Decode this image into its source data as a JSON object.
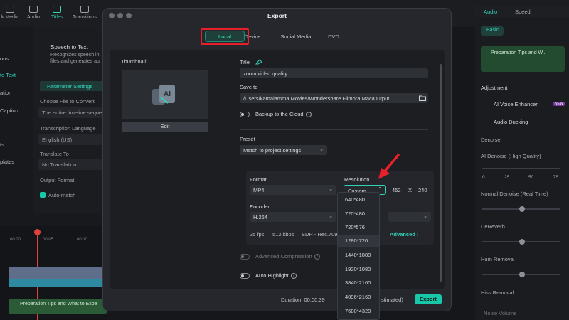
{
  "app_toolbar": {
    "tabs": [
      "k Media",
      "Audio",
      "Titles",
      "Transitions"
    ]
  },
  "left_rail": [
    "ons",
    "to Text",
    "ation",
    "Caption",
    "ts",
    "plates"
  ],
  "left_panel": {
    "heading": "Speech to Text",
    "desc1": "Recognizes speech in",
    "desc2": "files and generates au",
    "param_tab": "Parameter Settings",
    "choose_file_label": "Choose File to Convert",
    "choose_file_value": "The entire timeline seque",
    "language_label": "Transcription Language",
    "language_value": "English (US)",
    "translate_label": "Translate To",
    "translate_value": "No Translation",
    "output_label": "Output Format",
    "auto_match": "Auto-match"
  },
  "timeline": {
    "t1": "00:00",
    "t2": "00:05",
    "t3": "00:10",
    "clip_label": "Preparation Tips and What to Expe"
  },
  "right_panel": {
    "tab_audio": "Audio",
    "tab_speed": "Speed",
    "basic": "Basic",
    "clip_title": "Preparation Tips and W...",
    "adjustment": "Adjustment",
    "ai_voice": "AI Voice Enhancer",
    "new_badge": "NEW",
    "audio_ducking": "Audio Ducking",
    "denoise": "Denoise",
    "ai_denoise": "AI Denoise (High Quality)",
    "scale": [
      "0",
      "25",
      "50",
      "75"
    ],
    "normal_denoise": "Normal Denoise (Real Time)",
    "dereverb": "DeReverb",
    "hum_removal": "Hum Removal",
    "hiss_removal": "Hiss Removal",
    "noise_volume": "Noise Volume"
  },
  "dialog": {
    "title": "Export",
    "tabs": [
      "Local",
      "Device",
      "Social Media",
      "DVD"
    ],
    "active_tab": "Local",
    "thumbnail_label": "Thumbnail:",
    "edit_button": "Edit",
    "title_label": "Title",
    "title_value": "zoom video quality",
    "save_to_label": "Save to",
    "save_to_value": "/Users/kamalamma Movies/Wondershare Filmora Mac/Output",
    "backup_label": "Backup to the Cloud",
    "preset_label": "Preset",
    "preset_value": "Match to project settings",
    "format_label": "Format",
    "format_value": "MP4",
    "resolution_label": "Resolution",
    "resolution_value": "Custom",
    "res_width": "452",
    "res_x": "X",
    "res_height": "240",
    "encoder_label": "Encoder",
    "encoder_value": "H.264",
    "fps": "25 fps",
    "bitrate": "512 kbps",
    "color": "SDR - Rec.709",
    "advanced": "Advanced",
    "adv_compression": "Advanced Compression",
    "auto_highlight": "Auto Highlight",
    "duration": "Duration: 00:00:39",
    "estimated": "stimated)",
    "export_button": "Export",
    "resolution_options": [
      "640*480",
      "720*480",
      "720*576",
      "1280*720",
      "1440*1080",
      "1920*1080",
      "3840*2160",
      "4096*2160",
      "7680*4320"
    ],
    "selected_resolution": "1280*720"
  },
  "colors": {
    "accent": "#17c9a8",
    "highlight_red": "#e8202a"
  }
}
